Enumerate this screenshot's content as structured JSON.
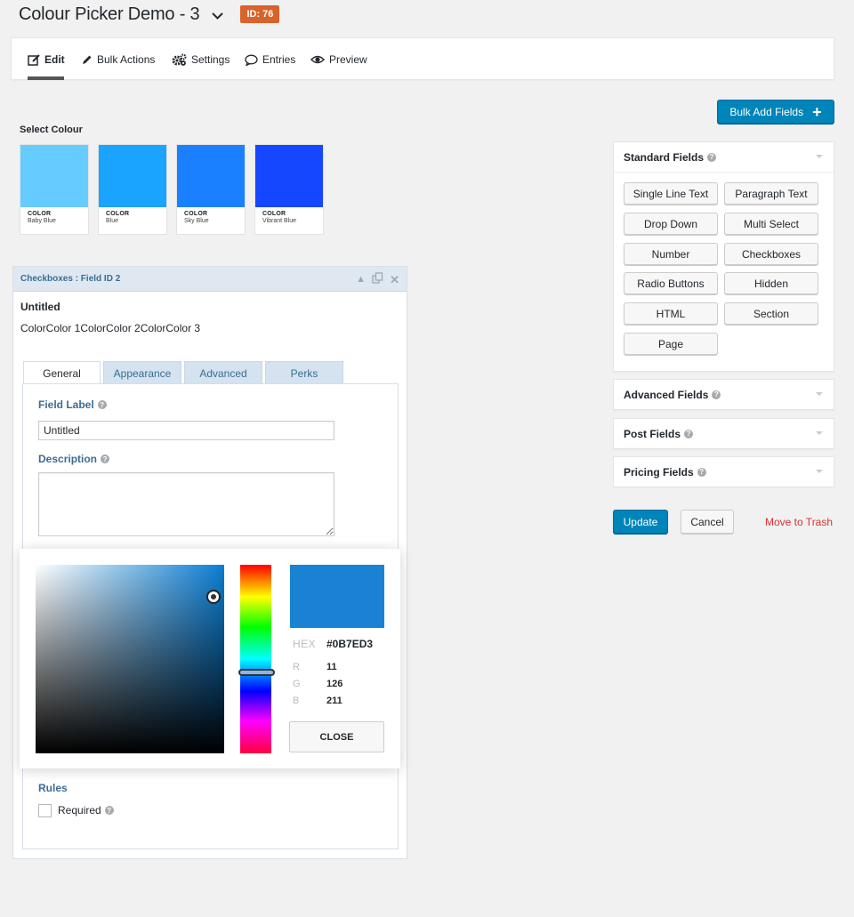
{
  "header": {
    "title": "Colour Picker Demo - 3",
    "id_badge": "ID: 76"
  },
  "toolbar": {
    "items": [
      {
        "label": "Edit",
        "icon": "edit-icon",
        "active": true
      },
      {
        "label": "Bulk Actions",
        "icon": "pencil-icon"
      },
      {
        "label": "Settings",
        "icon": "gears-icon"
      },
      {
        "label": "Entries",
        "icon": "comment-icon"
      },
      {
        "label": "Preview",
        "icon": "eye-icon"
      }
    ]
  },
  "bulk_add_label": "Bulk Add Fields",
  "select_colour": {
    "label": "Select Colour",
    "swatches": [
      {
        "code": "COLOR",
        "name": "Baby Blue",
        "color": "#66ccff"
      },
      {
        "code": "COLOR",
        "name": "Blue",
        "color": "#1aa3ff"
      },
      {
        "code": "COLOR",
        "name": "Sky Blue",
        "color": "#1a80ff"
      },
      {
        "code": "COLOR",
        "name": "Vibrant Blue",
        "color": "#1447ff"
      }
    ]
  },
  "field": {
    "header_title": "Checkboxes : Field ID 2",
    "label": "Untitled",
    "choices_text": "ColorColor 1ColorColor 2ColorColor 3",
    "tabs": [
      "General",
      "Appearance",
      "Advanced",
      "Perks"
    ],
    "field_label_title": "Field Label",
    "field_label_value": "Untitled",
    "description_title": "Description",
    "rules_title": "Rules",
    "required_label": "Required"
  },
  "picker": {
    "hex_key": "HEX",
    "hex_value": "#0B7ED3",
    "r_key": "R",
    "r_value": "11",
    "g_key": "G",
    "g_value": "126",
    "b_key": "B",
    "b_value": "211",
    "close_label": "CLOSE",
    "preview_color": "#1a82d2"
  },
  "sidebar": {
    "standard_title": "Standard Fields",
    "standard_buttons": [
      "Single Line Text",
      "Paragraph Text",
      "Drop Down",
      "Multi Select",
      "Number",
      "Checkboxes",
      "Radio Buttons",
      "Hidden",
      "HTML",
      "Section",
      "Page"
    ],
    "advanced_title": "Advanced Fields",
    "post_title": "Post Fields",
    "pricing_title": "Pricing Fields"
  },
  "actions": {
    "update": "Update",
    "cancel": "Cancel",
    "trash": "Move to Trash"
  }
}
